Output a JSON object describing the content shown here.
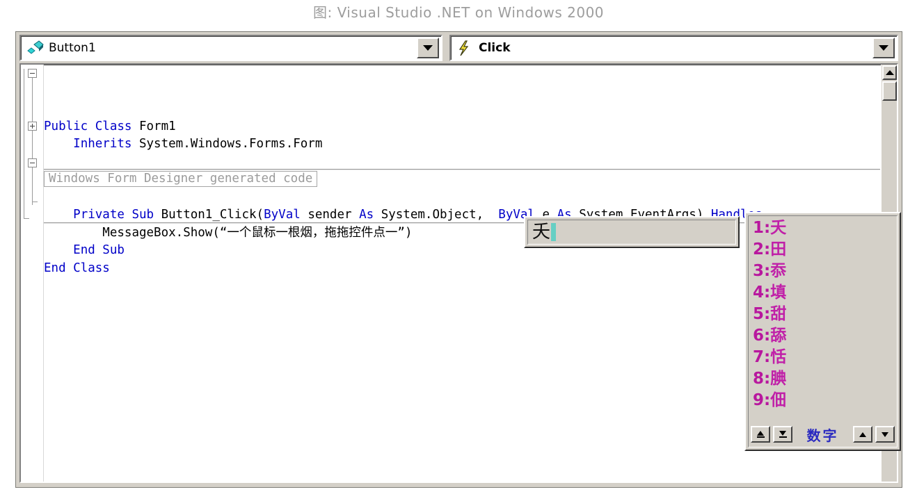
{
  "caption": "图: Visual Studio .NET on Windows 2000",
  "toolbar": {
    "object_combo": {
      "value": "Button1",
      "icon": "vb-object-icon",
      "dropdown_icon": "chevron-down-icon"
    },
    "event_combo": {
      "value": "Click",
      "icon": "lightning-bolt-icon",
      "dropdown_icon": "chevron-down-icon"
    }
  },
  "code": {
    "lines": [
      {
        "indent": 0,
        "fold": "minus",
        "tokens": [
          {
            "t": "Public Class ",
            "c": "kw"
          },
          {
            "t": "Form1",
            "c": "tx"
          }
        ]
      },
      {
        "indent": 1,
        "fold": "none",
        "tokens": [
          {
            "t": "Inherits ",
            "c": "kw"
          },
          {
            "t": "System.Windows.Forms.Form",
            "c": "tx"
          }
        ]
      },
      {
        "indent": 0,
        "fold": "none",
        "tokens": []
      },
      {
        "indent": 0,
        "fold": "plus",
        "region": "Windows Form Designer generated code",
        "tokens": []
      },
      {
        "indent": 0,
        "fold": "none",
        "tokens": []
      },
      {
        "indent": 1,
        "fold": "minus",
        "tokens": [
          {
            "t": "Private Sub ",
            "c": "kw"
          },
          {
            "t": "Button1_Click(",
            "c": "tx"
          },
          {
            "t": "ByVal ",
            "c": "kw"
          },
          {
            "t": "sender ",
            "c": "tx"
          },
          {
            "t": "As ",
            "c": "kw"
          },
          {
            "t": "System.Object,  ",
            "c": "tx"
          },
          {
            "t": "ByVal ",
            "c": "kw"
          },
          {
            "t": "e ",
            "c": "tx"
          },
          {
            "t": "As ",
            "c": "kw"
          },
          {
            "t": "System.EventArgs) ",
            "c": "tx"
          },
          {
            "t": "Handles",
            "c": "kw"
          }
        ]
      },
      {
        "indent": 2,
        "fold": "none",
        "tokens": [
          {
            "t": "MessageBox.Show(“一个鼠标一根烟，拖拖控件点一”)",
            "c": "tx"
          }
        ]
      },
      {
        "indent": 1,
        "fold": "none",
        "tokens": [
          {
            "t": "End Sub",
            "c": "kw"
          }
        ]
      },
      {
        "indent": 0,
        "fold": "end",
        "tokens": [
          {
            "t": "End Class",
            "c": "kw"
          }
        ]
      }
    ],
    "region_text": "Windows Form Designer generated code"
  },
  "scrollbar": {
    "up_icon": "triangle-up-icon",
    "thumb": "scroll-thumb"
  },
  "ime": {
    "composition": {
      "text": "夭",
      "caret": "text-caret"
    },
    "candidates": [
      {
        "index": "1",
        "char": "夭"
      },
      {
        "index": "2",
        "char": "田"
      },
      {
        "index": "3",
        "char": "忝"
      },
      {
        "index": "4",
        "char": "填"
      },
      {
        "index": "5",
        "char": "甜"
      },
      {
        "index": "6",
        "char": "舔"
      },
      {
        "index": "7",
        "char": "恬"
      },
      {
        "index": "8",
        "char": "腆"
      },
      {
        "index": "9",
        "char": "佃"
      }
    ],
    "footer": {
      "label": "数字",
      "buttons": [
        {
          "name": "page-first-button",
          "icon": "first-page-icon"
        },
        {
          "name": "page-last-button",
          "icon": "last-page-icon"
        },
        {
          "name": "page-up-button",
          "icon": "triangle-up-icon"
        },
        {
          "name": "page-down-button",
          "icon": "triangle-down-icon"
        }
      ]
    }
  },
  "colors": {
    "keyword": "#0000c8",
    "text": "#000000",
    "region_gray": "#9b9b9b",
    "candidate_magenta": "#c020a8",
    "ime_label_blue": "#2a2ac0",
    "caret_teal": "#66cfc4",
    "chrome": "#d4d0c8"
  }
}
